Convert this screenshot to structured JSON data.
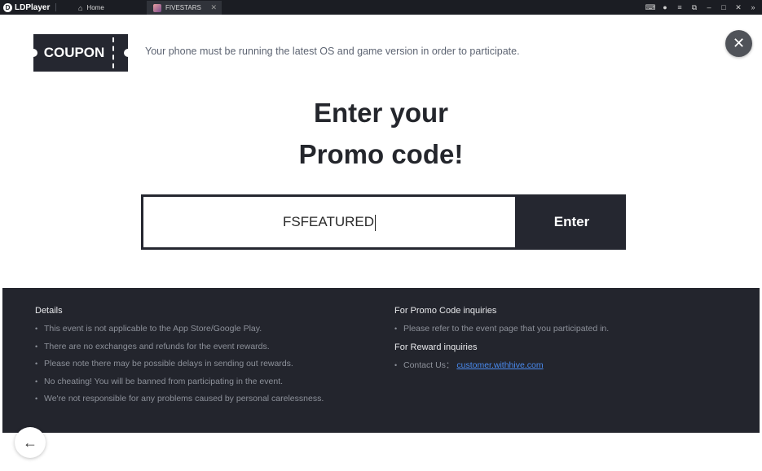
{
  "titlebar": {
    "brand": "LDPlayer",
    "tabs": [
      {
        "label": "Home",
        "icon": "home-icon"
      },
      {
        "label": "FIVESTARS",
        "icon": "game-thumbnail"
      }
    ],
    "controls": [
      "gamepad-icon",
      "account-icon",
      "menu-icon",
      "window-icon",
      "minimize-icon",
      "maximize-icon",
      "close-icon",
      "more-icon"
    ]
  },
  "coupon": {
    "label": "COUPON",
    "notice": "Your phone must be running the latest OS and game version in order to participate."
  },
  "headline": {
    "line1": "Enter your",
    "line2": "Promo code!"
  },
  "promo": {
    "value": "FSFEATURED",
    "enter_label": "Enter"
  },
  "details": {
    "title": "Details",
    "items": [
      "This event is not applicable to the App Store/Google Play.",
      "There are no exchanges and refunds for the event rewards.",
      "Please note there may be possible delays in sending out rewards.",
      "No cheating! You will be banned from participating in the event.",
      "We're not responsible for any problems caused by personal carelessness."
    ]
  },
  "inquiries": {
    "promo_title": "For Promo Code inquiries",
    "promo_item": "Please refer to the event page that you participated in.",
    "reward_title": "For Reward inquiries",
    "contact_label": "Contact Us：",
    "contact_email": "customer.withhive.com"
  },
  "colors": {
    "dark_panel": "#23252d",
    "link": "#4a8bf0"
  }
}
